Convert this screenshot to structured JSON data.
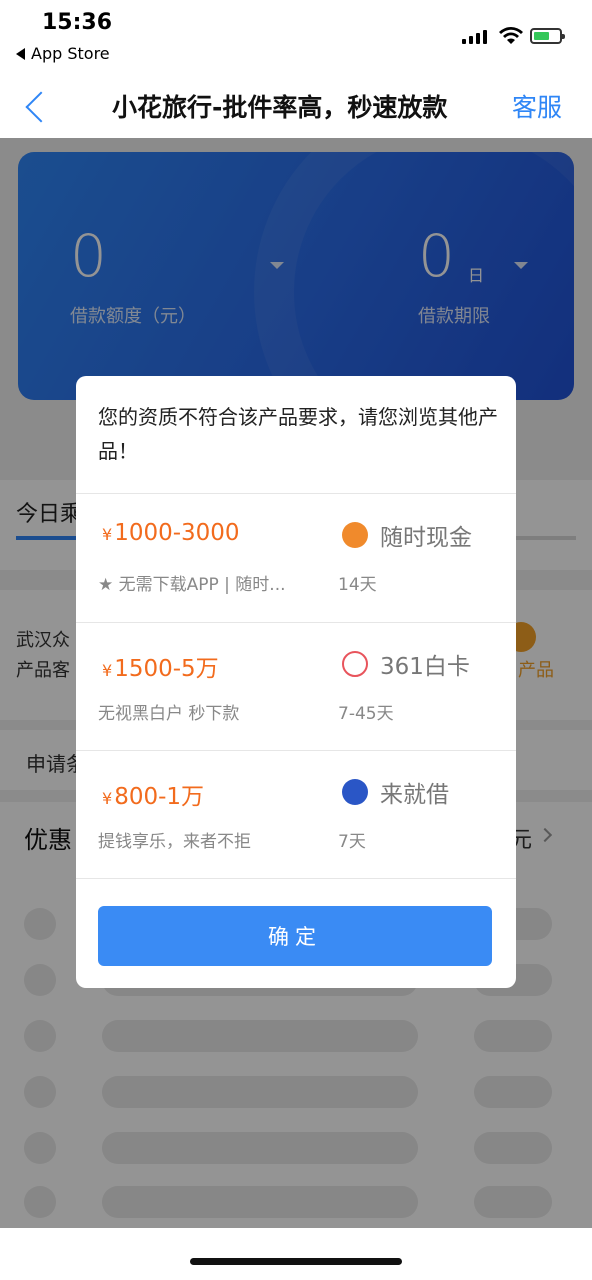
{
  "status_bar": {
    "time": "15:36",
    "back_label": "App Store"
  },
  "nav": {
    "title": "小花旅行-批件率高，秒速放款",
    "service_label": "客服"
  },
  "loan_card": {
    "amount_value": "0",
    "amount_label": "借款额度（元）",
    "term_value": "0",
    "term_unit": "日",
    "term_label": "借款期限"
  },
  "background": {
    "tab_today": "今日乘",
    "company_line1": "武汉众",
    "company_line2": "产品客",
    "product_right": "产品",
    "apply_label": "申请条",
    "promo_label": "优惠",
    "promo_right": "元"
  },
  "modal": {
    "message": "您的资质不符合该产品要求，请您浏览其他产品！",
    "products": [
      {
        "currency": "¥",
        "range": "1000-3000",
        "desc": "★ 无需下载APP | 随时...",
        "name": "随时现金",
        "term": "14天",
        "logo_color": "#f08a2c"
      },
      {
        "currency": "¥",
        "range": "1500-5万",
        "desc": "无视黑白户 秒下款",
        "name": "361白卡",
        "term": "7-45天",
        "logo_color": "#e8545c"
      },
      {
        "currency": "¥",
        "range": "800-1万",
        "desc": "提钱享乐，来者不拒",
        "name": "来就借",
        "term": "7天",
        "logo_color": "#2a56c6"
      }
    ],
    "confirm_label": "确定"
  }
}
